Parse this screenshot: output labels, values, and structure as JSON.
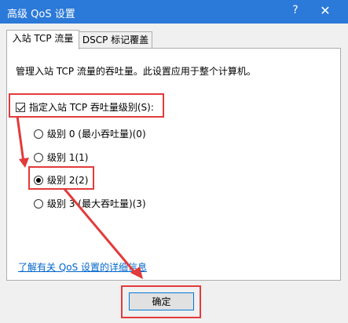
{
  "window": {
    "title": "高级 QoS 设置",
    "help": "?",
    "close": "✕"
  },
  "tabs": [
    {
      "label": "入站 TCP 流量",
      "active": true
    },
    {
      "label": "DSCP 标记覆盖",
      "active": false
    }
  ],
  "panel": {
    "description": "管理入站 TCP 流量的吞吐量。此设置应用于整个计算机。",
    "checkbox": {
      "label": "指定入站 TCP 吞吐量级别(S):",
      "checked": true
    },
    "radios": [
      {
        "label": "级别 0 (最小吞吐量)(0)",
        "selected": false
      },
      {
        "label": "级别 1(1)",
        "selected": false
      },
      {
        "label": "级别 2(2)",
        "selected": true
      },
      {
        "label": "级别 3 (最大吞吐量)(3)",
        "selected": false
      }
    ],
    "link": "了解有关 QoS 设置的详细信息"
  },
  "ok_button": "确定",
  "annotation_color": "#e23b3b"
}
